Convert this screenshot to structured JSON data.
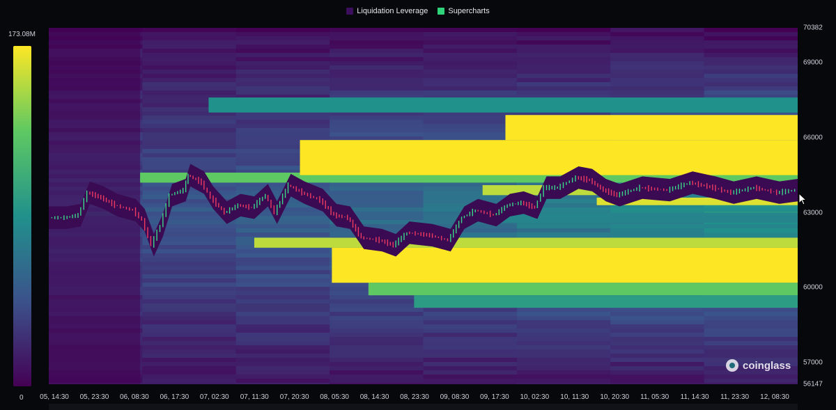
{
  "legend": {
    "items": [
      {
        "label": "Liquidation Leverage",
        "color": "#3b0f5c"
      },
      {
        "label": "Supercharts",
        "color": "#2fd37a"
      }
    ]
  },
  "colorbar": {
    "max_label": "173.08M",
    "min_label": "0",
    "colors": [
      "#440154",
      "#3b528b",
      "#21918c",
      "#5ec962",
      "#fde725"
    ]
  },
  "watermark": {
    "text": "coinglass",
    "icon": "coinglass-logo-icon"
  },
  "cursor": {
    "icon": "mouse-pointer-icon"
  },
  "chart_data": {
    "type": "heatmap",
    "title": "",
    "xlabel": "",
    "ylabel": "",
    "ylim": [
      56147,
      70382
    ],
    "x_ticks": [
      "05, 14:30",
      "05, 23:30",
      "06, 08:30",
      "06, 17:30",
      "07, 02:30",
      "07, 11:30",
      "07, 20:30",
      "08, 05:30",
      "08, 14:30",
      "08, 23:30",
      "09, 08:30",
      "09, 17:30",
      "10, 02:30",
      "10, 11:30",
      "10, 20:30",
      "11, 05:30",
      "11, 14:30",
      "11, 23:30",
      "12, 08:30"
    ],
    "y_ticks": [
      "70382",
      "69000",
      "66000",
      "63000",
      "60000",
      "57000",
      "56147"
    ],
    "y_tick_values": [
      70382,
      69000,
      66000,
      63000,
      60000,
      57000,
      56147
    ],
    "color_scale": {
      "min": 0,
      "max": 173080000,
      "unit": "USD"
    },
    "time_range_hours": [
      0,
      164
    ],
    "bands": [
      {
        "price_low": 64200,
        "price_high": 64600,
        "start_h": 20,
        "end_h": 164,
        "intensity": 0.75
      },
      {
        "price_low": 64500,
        "price_high": 65900,
        "start_h": 55,
        "end_h": 164,
        "intensity": 1.0
      },
      {
        "price_low": 65900,
        "price_high": 66900,
        "start_h": 100,
        "end_h": 164,
        "intensity": 1.0
      },
      {
        "price_low": 67000,
        "price_high": 67600,
        "start_h": 35,
        "end_h": 164,
        "intensity": 0.5
      },
      {
        "price_low": 61600,
        "price_high": 62000,
        "start_h": 45,
        "end_h": 164,
        "intensity": 0.9
      },
      {
        "price_low": 60200,
        "price_high": 61600,
        "start_h": 62,
        "end_h": 164,
        "intensity": 1.0
      },
      {
        "price_low": 59700,
        "price_high": 60200,
        "start_h": 70,
        "end_h": 164,
        "intensity": 0.75
      },
      {
        "price_low": 59200,
        "price_high": 59700,
        "start_h": 80,
        "end_h": 164,
        "intensity": 0.55
      },
      {
        "price_low": 63300,
        "price_high": 63600,
        "start_h": 120,
        "end_h": 164,
        "intensity": 0.95
      },
      {
        "price_low": 62600,
        "price_high": 63000,
        "start_h": 95,
        "end_h": 164,
        "intensity": 0.45
      },
      {
        "price_low": 63700,
        "price_high": 64100,
        "start_h": 95,
        "end_h": 125,
        "intensity": 0.9
      }
    ],
    "price_series": [
      {
        "h": 0,
        "p": 62800
      },
      {
        "h": 4,
        "p": 62800
      },
      {
        "h": 7,
        "p": 62900
      },
      {
        "h": 9,
        "p": 63800
      },
      {
        "h": 12,
        "p": 63600
      },
      {
        "h": 15,
        "p": 63300
      },
      {
        "h": 19,
        "p": 63100
      },
      {
        "h": 21,
        "p": 62700
      },
      {
        "h": 23,
        "p": 61700
      },
      {
        "h": 25,
        "p": 62500
      },
      {
        "h": 27,
        "p": 63700
      },
      {
        "h": 30,
        "p": 63900
      },
      {
        "h": 31,
        "p": 64500
      },
      {
        "h": 34,
        "p": 64200
      },
      {
        "h": 36,
        "p": 63600
      },
      {
        "h": 39,
        "p": 63000
      },
      {
        "h": 42,
        "p": 63300
      },
      {
        "h": 45,
        "p": 63200
      },
      {
        "h": 48,
        "p": 63700
      },
      {
        "h": 50,
        "p": 63000
      },
      {
        "h": 53,
        "p": 64100
      },
      {
        "h": 56,
        "p": 63800
      },
      {
        "h": 60,
        "p": 63500
      },
      {
        "h": 63,
        "p": 62900
      },
      {
        "h": 66,
        "p": 62800
      },
      {
        "h": 69,
        "p": 62000
      },
      {
        "h": 73,
        "p": 61900
      },
      {
        "h": 76,
        "p": 61700
      },
      {
        "h": 79,
        "p": 62200
      },
      {
        "h": 84,
        "p": 62100
      },
      {
        "h": 88,
        "p": 61900
      },
      {
        "h": 91,
        "p": 62800
      },
      {
        "h": 94,
        "p": 63100
      },
      {
        "h": 98,
        "p": 62900
      },
      {
        "h": 101,
        "p": 63300
      },
      {
        "h": 104,
        "p": 63400
      },
      {
        "h": 107,
        "p": 63200
      },
      {
        "h": 109,
        "p": 64000
      },
      {
        "h": 112,
        "p": 64000
      },
      {
        "h": 116,
        "p": 64400
      },
      {
        "h": 119,
        "p": 64300
      },
      {
        "h": 122,
        "p": 63900
      },
      {
        "h": 125,
        "p": 63700
      },
      {
        "h": 130,
        "p": 64000
      },
      {
        "h": 136,
        "p": 63900
      },
      {
        "h": 141,
        "p": 64200
      },
      {
        "h": 146,
        "p": 64000
      },
      {
        "h": 150,
        "p": 63800
      },
      {
        "h": 155,
        "p": 64000
      },
      {
        "h": 160,
        "p": 63800
      },
      {
        "h": 164,
        "p": 63900
      }
    ]
  }
}
